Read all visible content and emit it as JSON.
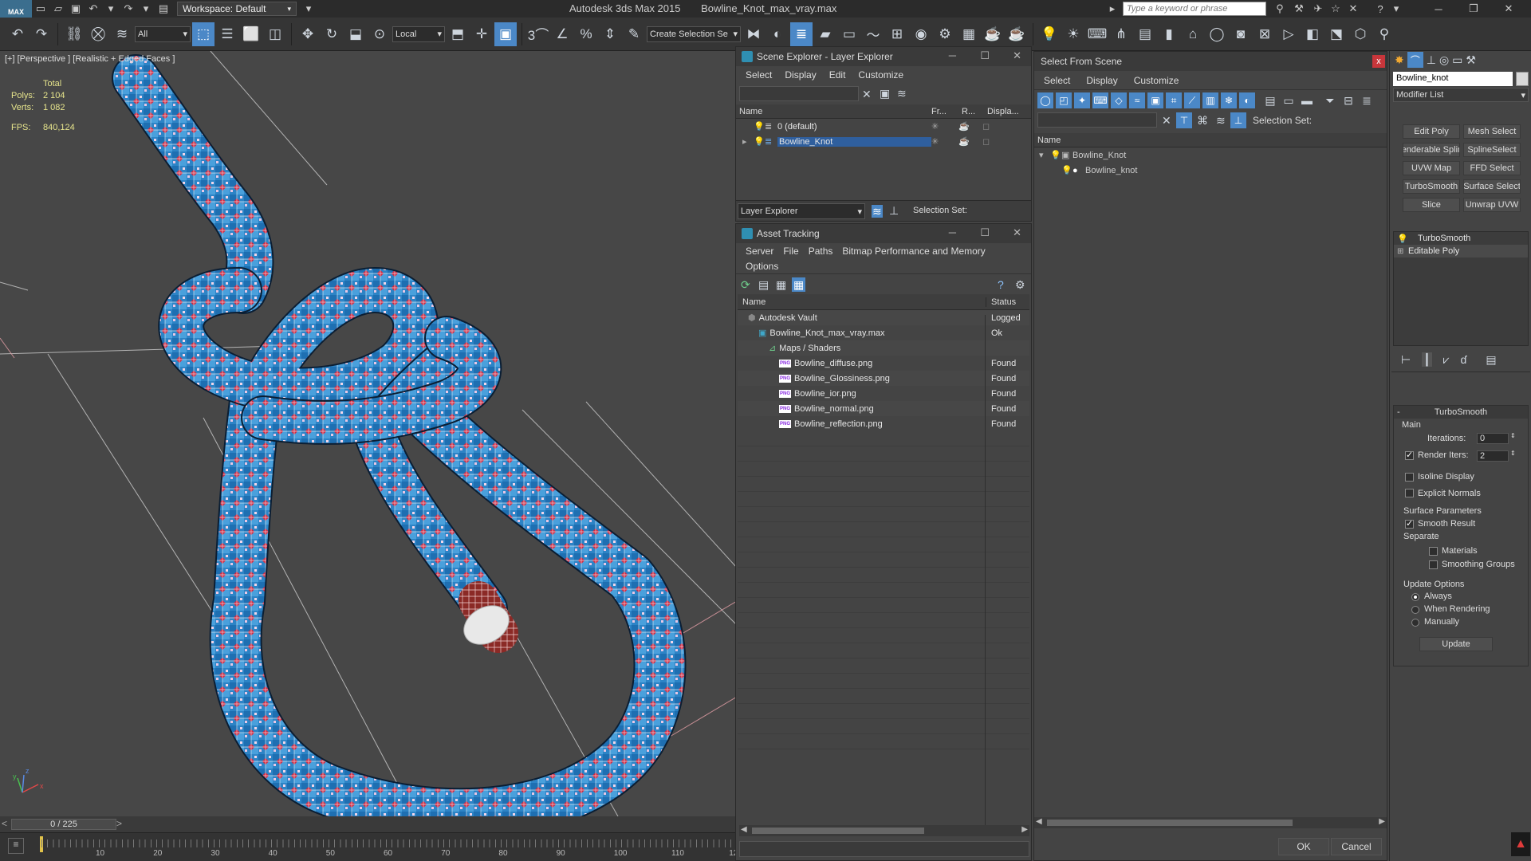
{
  "titlebar": {
    "logo": "MAX",
    "workspace_label": "Workspace: Default",
    "app_name": "Autodesk 3ds Max  2015",
    "file_name": "Bowline_Knot_max_vray.max",
    "search_placeholder": "Type a keyword or phrase"
  },
  "toolbar": {
    "selection_filter": "All",
    "reference_coord": "Local",
    "named_selection": "Create Selection Se"
  },
  "viewport": {
    "label": "[+] [Perspective ] [Realistic + Edged Faces ]",
    "stats_header": "Total",
    "polys_label": "Polys:",
    "polys_value": "2 104",
    "verts_label": "Verts:",
    "verts_value": "1 082",
    "fps_label": "FPS:",
    "fps_value": "840,124",
    "axis_x": "x",
    "axis_y": "y",
    "axis_z": "z"
  },
  "timeslider": {
    "frame": "0 / 225",
    "prev": "<",
    "next": ">",
    "ticks": [
      "10",
      "20",
      "30",
      "40",
      "50",
      "60",
      "70",
      "80",
      "90",
      "100",
      "110",
      "12"
    ]
  },
  "scene_explorer": {
    "title": "Scene Explorer - Layer Explorer",
    "menu": [
      "Select",
      "Display",
      "Edit",
      "Customize"
    ],
    "col_name": "Name",
    "col_freeze": "Fr...",
    "col_render": "R...",
    "col_display": "Displa...",
    "rows": [
      {
        "name": "0 (default)",
        "selected": false
      },
      {
        "name": "Bowline_Knot",
        "selected": true
      }
    ],
    "footer_dropdown": "Layer Explorer",
    "footer_selection": "Selection Set:"
  },
  "asset_tracking": {
    "title": "Asset Tracking",
    "menu_row1": [
      "Server",
      "File",
      "Paths",
      "Bitmap Performance and Memory"
    ],
    "menu_row2": [
      "Options"
    ],
    "col_name": "Name",
    "col_status": "Status",
    "rows": [
      {
        "name": "Autodesk Vault",
        "status": "Logged Out",
        "indent": 1,
        "icon": "vault-icon"
      },
      {
        "name": "Bowline_Knot_max_vray.max",
        "status": "Ok",
        "indent": 2,
        "icon": "max-file-icon"
      },
      {
        "name": "Maps / Shaders",
        "status": "",
        "indent": 3,
        "icon": "maps-folder-icon"
      },
      {
        "name": "Bowline_diffuse.png",
        "status": "Found",
        "indent": 4,
        "icon": "png-icon"
      },
      {
        "name": "Bowline_Glossiness.png",
        "status": "Found",
        "indent": 4,
        "icon": "png-icon"
      },
      {
        "name": "Bowline_ior.png",
        "status": "Found",
        "indent": 4,
        "icon": "png-icon"
      },
      {
        "name": "Bowline_normal.png",
        "status": "Found",
        "indent": 4,
        "icon": "png-icon"
      },
      {
        "name": "Bowline_reflection.png",
        "status": "Found",
        "indent": 4,
        "icon": "png-icon"
      }
    ],
    "png_badge": "PNG"
  },
  "select_from_scene": {
    "title": "Select From Scene",
    "close": "x",
    "menu": [
      "Select",
      "Display",
      "Customize"
    ],
    "selection_set": "Selection Set:",
    "col_name": "Name",
    "rows": [
      {
        "name": "Bowline_Knot",
        "level": 0
      },
      {
        "name": "Bowline_knot",
        "level": 1
      }
    ],
    "ok": "OK",
    "cancel": "Cancel"
  },
  "command_panel": {
    "object_name": "Bowline_knot",
    "modifier_list": "Modifier List",
    "modifier_buttons": [
      "Edit Poly",
      "Mesh Select",
      "Renderable Spline",
      "SplineSelect",
      "UVW Map",
      "FFD Select",
      "TurboSmooth",
      "Surface Select",
      "Slice",
      "Unwrap UVW"
    ],
    "stack": [
      "TurboSmooth",
      "Editable Poly"
    ],
    "rollout_title": "TurboSmooth",
    "main_label": "Main",
    "iterations_label": "Iterations:",
    "iterations_value": "0",
    "render_iters_label": "Render Iters:",
    "render_iters_value": "2",
    "render_iters_checked": true,
    "isoline_label": "Isoline Display",
    "explicit_label": "Explicit Normals",
    "surface_params_label": "Surface Parameters",
    "smooth_result_label": "Smooth Result",
    "separate_label": "Separate",
    "materials_label": "Materials",
    "smoothing_groups_label": "Smoothing Groups",
    "update_options_label": "Update Options",
    "always_label": "Always",
    "when_rendering_label": "When Rendering",
    "manually_label": "Manually",
    "update_button": "Update"
  },
  "colors": {
    "accent": "#4b88c7",
    "selected_row": "#2f5f9e",
    "rope_blue": "#2d84c6",
    "rope_red": "#d7263d",
    "grid_line": "#d8d8d8"
  }
}
